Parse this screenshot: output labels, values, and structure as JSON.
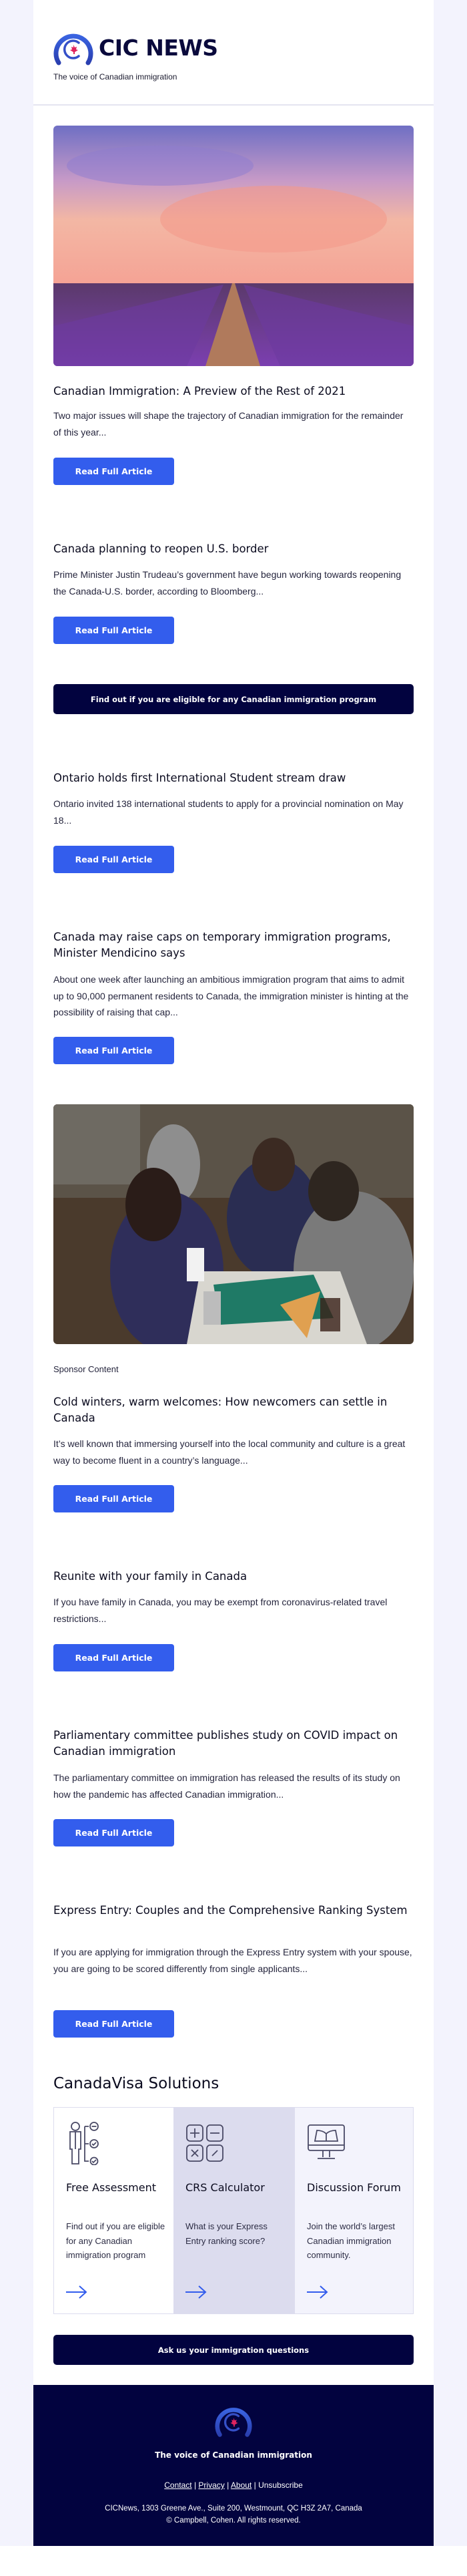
{
  "header": {
    "logo_text": "CIC NEWS",
    "tagline": "The voice of Canadian immigration"
  },
  "articles": [
    {
      "title": "Canadian Immigration: A Preview of the Rest of 2021",
      "excerpt": "Two major issues will shape the trajectory of Canadian immigration for the remainder of this year...",
      "button": "Read Full Article",
      "image": "lavender-field-sunset"
    },
    {
      "title": "Canada planning to reopen U.S. border",
      "excerpt": "Prime Minister Justin Trudeau’s government have begun working towards reopening the Canada-U.S. border, according to Bloomberg...",
      "button": "Read Full Article"
    },
    {
      "title": "Ontario holds first International Student stream draw",
      "excerpt": "Ontario invited 138 international students to apply for a provincial nomination on May 18...",
      "button": "Read Full Article"
    },
    {
      "title": "Canada may raise caps on temporary immigration programs, Minister Mendicino says",
      "excerpt": "About one week after launching an ambitious immigration program that aims to admit up to 90,000 permanent residents to Canada, the immigration minister is hinting at the possibility of raising that cap...",
      "button": "Read Full Article"
    },
    {
      "label": "Sponsor Content",
      "title": "Cold winters, warm welcomes: How newcomers can settle in Canada",
      "excerpt": "It’s well known that immersing yourself into the local community and culture is a great way to become fluent in a country’s language...",
      "button": "Read Full Article",
      "image": "friends-at-cafe-table"
    },
    {
      "title": "Reunite with your family in Canada",
      "excerpt": "If you have family in Canada, you may be exempt from coronavirus-related travel restrictions...",
      "button": "Read Full Article"
    },
    {
      "title": "Parliamentary committee publishes study on COVID impact on Canadian immigration",
      "excerpt": "The parliamentary committee on immigration has released the results of its study on how the pandemic has affected Canadian immigration...",
      "button": "Read Full Article"
    },
    {
      "title": "Express Entry: Couples and the Comprehensive Ranking System",
      "excerpt": "If you are applying for immigration through the Express Entry system with your spouse, you are going to be scored differently from single applicants...",
      "button": "Read Full Article"
    }
  ],
  "eligibility_cta": "Find out if you are eligible for any Canadian immigration program",
  "solutions": {
    "heading": "CanadaVisa Solutions",
    "cards": [
      {
        "title": "Free Assessment",
        "body": "Find out if you are eligible for any Canadian immigration program",
        "icon": "assessment-icon"
      },
      {
        "title": "CRS Calculator",
        "body": "What is your Express Entry ranking score?",
        "icon": "calculator-icon"
      },
      {
        "title": "Discussion Forum",
        "body": "Join the world’s largest Canadian immigration community.",
        "icon": "forum-icon"
      }
    ]
  },
  "ask_cta": "Ask us your immigration questions",
  "footer": {
    "tagline": "The voice of Canadian immigration",
    "links": [
      "Contact",
      "Privacy",
      "About",
      "Unsubscribe"
    ],
    "separator": "|",
    "address": "CICNews, 1303 Greene Ave., Suite 200, Westmount, QC H3Z 2A7, Canada",
    "copyright": "© Campbell, Cohen. All rights reserved."
  },
  "colors": {
    "primary_button": "#335ded",
    "dark_navy": "#02033f",
    "page_bg": "#f3f3fd",
    "maple_red": "#e0245e"
  }
}
